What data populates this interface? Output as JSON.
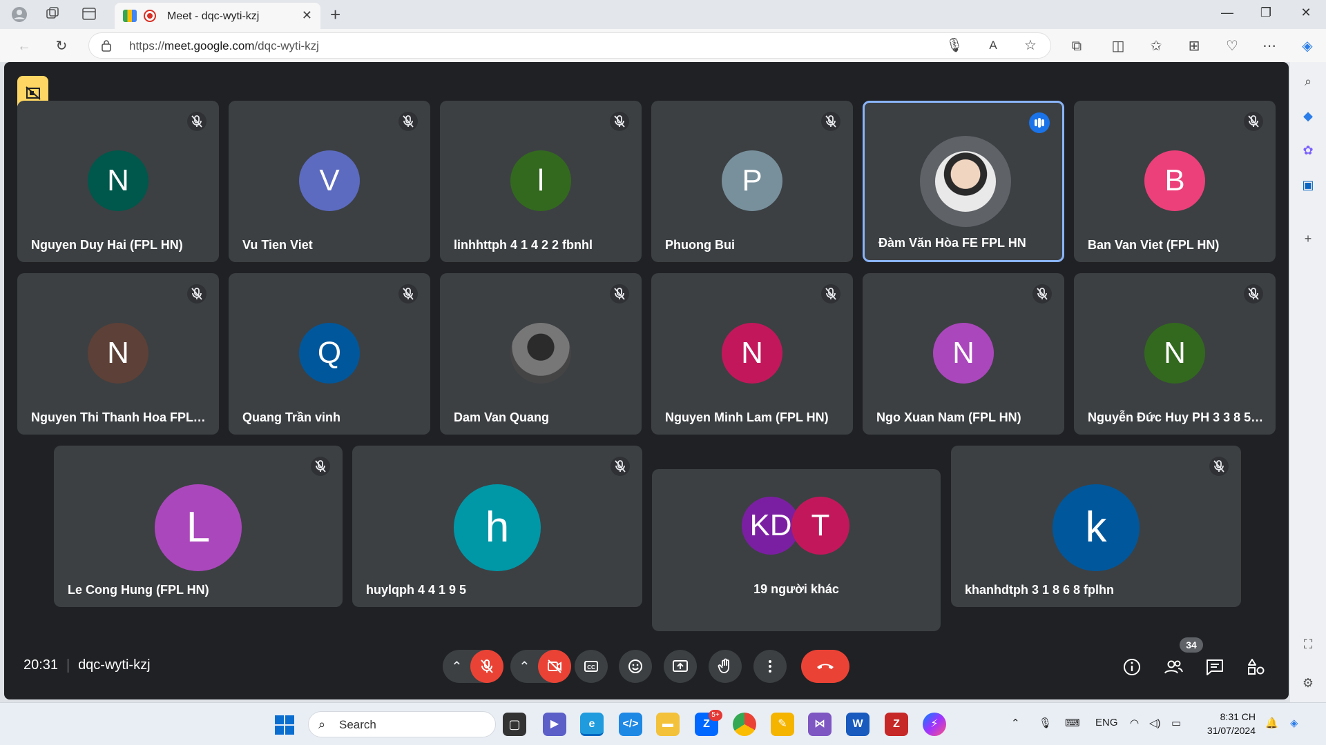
{
  "browser": {
    "tab_title": "Meet - dqc-wyti-kzj",
    "url_prefix": "https://",
    "url_host": "meet.google.com",
    "url_path": "/dqc-wyti-kzj"
  },
  "meeting": {
    "time": "20:31",
    "code": "dqc-wyti-kzj",
    "participant_count": "34",
    "others_label": "19 người khác"
  },
  "participants": [
    {
      "initial": "N",
      "name": "Nguyen Duy Hai (FPL HN)",
      "color": "#00574b"
    },
    {
      "initial": "V",
      "name": "Vu Tien Viet",
      "color": "#5c6bc0"
    },
    {
      "initial": "l",
      "name": "linhhttph 4 1 4 2 2 fbnhl",
      "color": "#33691e"
    },
    {
      "initial": "P",
      "name": "Phuong Bui",
      "color": "#78909c"
    },
    {
      "initial": "",
      "name": "Đàm Văn Hòa FE FPL HN",
      "color": "#5f6368"
    },
    {
      "initial": "B",
      "name": "Ban Van Viet (FPL HN)",
      "color": "#ec407a"
    },
    {
      "initial": "N",
      "name": "Nguyen Thi Thanh Hoa FPL HN",
      "color": "#5d4037"
    },
    {
      "initial": "Q",
      "name": "Quang Trần vinh",
      "color": "#01579b"
    },
    {
      "initial": "",
      "name": "Dam Van Quang",
      "color": "#555555"
    },
    {
      "initial": "N",
      "name": "Nguyen Minh Lam (FPL HN)",
      "color": "#c2185b"
    },
    {
      "initial": "N",
      "name": "Ngo Xuan Nam (FPL HN)",
      "color": "#ab47bc"
    },
    {
      "initial": "N",
      "name": "Nguyễn Đức Huy PH 3 3 8 5 ...",
      "color": "#33691e"
    },
    {
      "initial": "L",
      "name": "Le Cong Hung (FPL HN)",
      "color": "#ab47bc"
    },
    {
      "initial": "h",
      "name": "huylqph 4 4 1 9 5",
      "color": "#0097a7"
    },
    {
      "initial": "k",
      "name": "khanhdtph 3 1 8 6 8 fplhn",
      "color": "#01579b"
    }
  ],
  "others_avatars": [
    {
      "initial": "KD",
      "color": "#7b1fa2"
    },
    {
      "initial": "T",
      "color": "#c2185b"
    }
  ],
  "taskbar": {
    "search_placeholder": "Search",
    "language": "ENG",
    "time": "8:31 CH",
    "date": "31/07/2024",
    "zalo_badge": "5+"
  },
  "colors": {
    "meet_bg": "#202124",
    "tile_bg": "#3c4043",
    "active_border": "#8ab4f8",
    "danger": "#ea4335",
    "recording_badge": "#fdd663"
  }
}
